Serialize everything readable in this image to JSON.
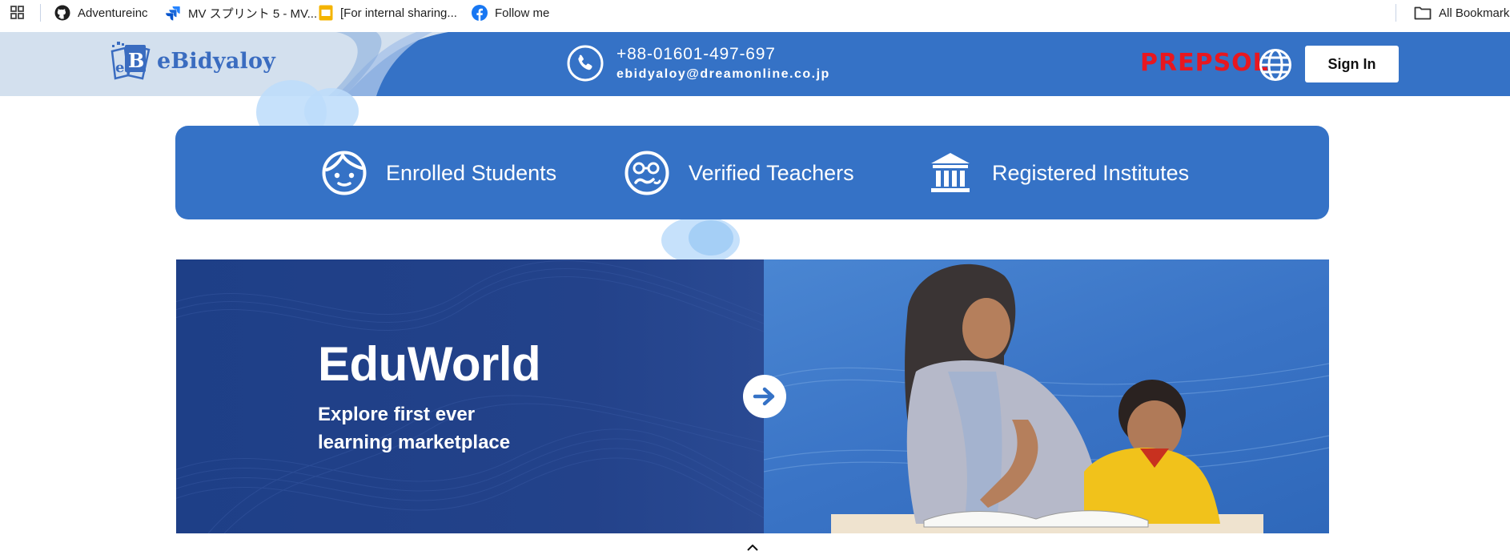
{
  "bookmarks_bar": {
    "items": [
      {
        "label": "Adventureinc",
        "icon": "github-icon"
      },
      {
        "label": "MV スプリント 5 - MV...",
        "icon": "jira-icon"
      },
      {
        "label": "[For internal sharing...",
        "icon": "slides-icon"
      },
      {
        "label": "Follow me",
        "icon": "facebook-icon"
      }
    ],
    "all_bookmarks": "All Bookmarks"
  },
  "header": {
    "logo_text": "eBidyaloy",
    "phone": "+88-01601-497-697",
    "email": "ebidyaloy@dreamonline.co.jp",
    "partner_brand": "PREPSOL",
    "sign_in": "Sign In"
  },
  "stats": [
    {
      "label": "Enrolled Students",
      "icon": "student-face-icon"
    },
    {
      "label": "Verified Teachers",
      "icon": "teacher-face-icon"
    },
    {
      "label": "Registered Institutes",
      "icon": "institute-building-icon"
    }
  ],
  "banner": {
    "title": "EduWorld",
    "subtitle_line1": "Explore first ever",
    "subtitle_line2": "learning marketplace",
    "arrow_icon": "arrow-right-icon"
  },
  "colors": {
    "brand_blue": "#3572c6",
    "banner_navy": "#1e3f87",
    "prepsol_red": "#e8171f",
    "logo_blue": "#3a6cc0"
  }
}
